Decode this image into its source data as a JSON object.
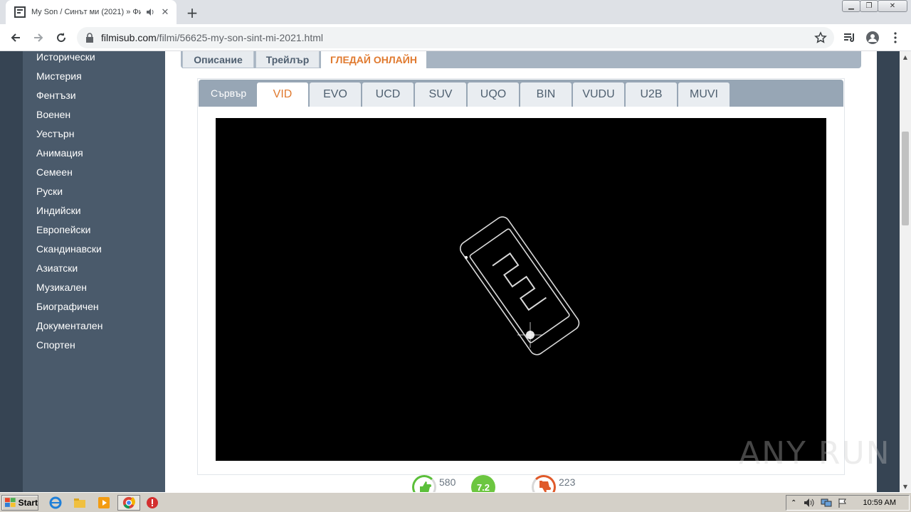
{
  "browser": {
    "tab_title": "My Son / Синът ми (2021) » Фи",
    "new_tab_label": "+",
    "url_domain": "filmisub.com",
    "url_path": "/filmi/56625-my-son-sint-mi-2021.html"
  },
  "sidebar": {
    "items": [
      "Исторически",
      "Мистерия",
      "Фентъзи",
      "Военен",
      "Уестърн",
      "Анимация",
      "Семеен",
      "Руски",
      "Индийски",
      "Европейски",
      "Скандинавски",
      "Азиатски",
      "Музикален",
      "Биографичен",
      "Документален",
      "Спортен"
    ]
  },
  "content_tabs": {
    "description": "Описание",
    "trailer": "Трейлър",
    "watch_online": "ГЛЕДАЙ ОНЛАЙН"
  },
  "servers": {
    "label": "Сървър",
    "items": [
      "VID",
      "EVO",
      "UCD",
      "SUV",
      "UQO",
      "BIN",
      "VUDU",
      "U2B",
      "MUVI"
    ],
    "active": "VID"
  },
  "ratings": {
    "likes": "580",
    "score": "7.2",
    "dislikes": "223"
  },
  "watermark": "ANY RUN",
  "taskbar": {
    "start_label": "Start",
    "clock": "10:59 AM"
  },
  "colors": {
    "accent": "#e07a2f",
    "sidebar_bg": "#4a5a6b",
    "server_bar": "#97a6b5",
    "like_green": "#5bbf3a",
    "dislike_orange": "#e05a2a"
  }
}
